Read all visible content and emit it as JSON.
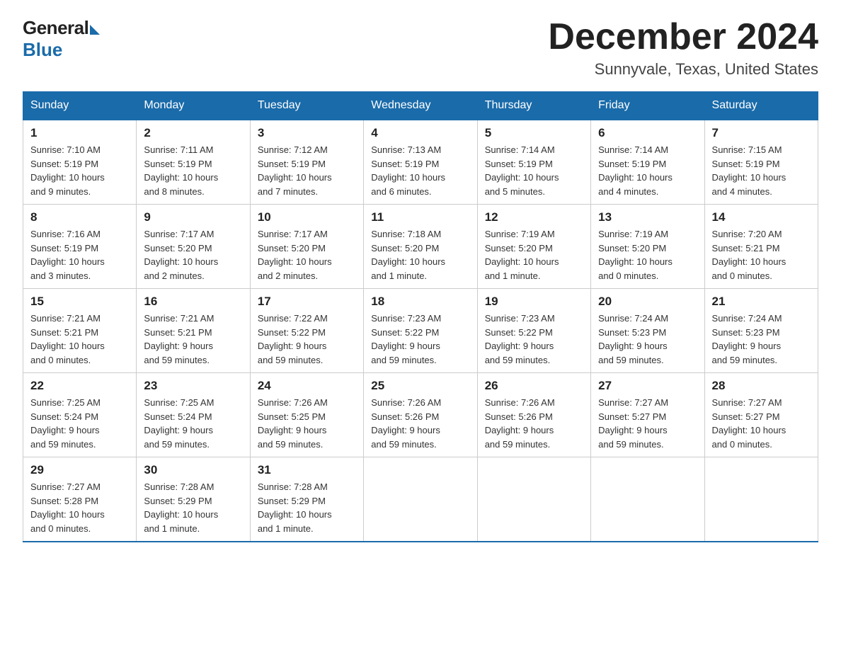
{
  "logo": {
    "general": "General",
    "blue": "Blue"
  },
  "title": "December 2024",
  "location": "Sunnyvale, Texas, United States",
  "days_of_week": [
    "Sunday",
    "Monday",
    "Tuesday",
    "Wednesday",
    "Thursday",
    "Friday",
    "Saturday"
  ],
  "weeks": [
    [
      {
        "day": "1",
        "info": "Sunrise: 7:10 AM\nSunset: 5:19 PM\nDaylight: 10 hours\nand 9 minutes."
      },
      {
        "day": "2",
        "info": "Sunrise: 7:11 AM\nSunset: 5:19 PM\nDaylight: 10 hours\nand 8 minutes."
      },
      {
        "day": "3",
        "info": "Sunrise: 7:12 AM\nSunset: 5:19 PM\nDaylight: 10 hours\nand 7 minutes."
      },
      {
        "day": "4",
        "info": "Sunrise: 7:13 AM\nSunset: 5:19 PM\nDaylight: 10 hours\nand 6 minutes."
      },
      {
        "day": "5",
        "info": "Sunrise: 7:14 AM\nSunset: 5:19 PM\nDaylight: 10 hours\nand 5 minutes."
      },
      {
        "day": "6",
        "info": "Sunrise: 7:14 AM\nSunset: 5:19 PM\nDaylight: 10 hours\nand 4 minutes."
      },
      {
        "day": "7",
        "info": "Sunrise: 7:15 AM\nSunset: 5:19 PM\nDaylight: 10 hours\nand 4 minutes."
      }
    ],
    [
      {
        "day": "8",
        "info": "Sunrise: 7:16 AM\nSunset: 5:19 PM\nDaylight: 10 hours\nand 3 minutes."
      },
      {
        "day": "9",
        "info": "Sunrise: 7:17 AM\nSunset: 5:20 PM\nDaylight: 10 hours\nand 2 minutes."
      },
      {
        "day": "10",
        "info": "Sunrise: 7:17 AM\nSunset: 5:20 PM\nDaylight: 10 hours\nand 2 minutes."
      },
      {
        "day": "11",
        "info": "Sunrise: 7:18 AM\nSunset: 5:20 PM\nDaylight: 10 hours\nand 1 minute."
      },
      {
        "day": "12",
        "info": "Sunrise: 7:19 AM\nSunset: 5:20 PM\nDaylight: 10 hours\nand 1 minute."
      },
      {
        "day": "13",
        "info": "Sunrise: 7:19 AM\nSunset: 5:20 PM\nDaylight: 10 hours\nand 0 minutes."
      },
      {
        "day": "14",
        "info": "Sunrise: 7:20 AM\nSunset: 5:21 PM\nDaylight: 10 hours\nand 0 minutes."
      }
    ],
    [
      {
        "day": "15",
        "info": "Sunrise: 7:21 AM\nSunset: 5:21 PM\nDaylight: 10 hours\nand 0 minutes."
      },
      {
        "day": "16",
        "info": "Sunrise: 7:21 AM\nSunset: 5:21 PM\nDaylight: 9 hours\nand 59 minutes."
      },
      {
        "day": "17",
        "info": "Sunrise: 7:22 AM\nSunset: 5:22 PM\nDaylight: 9 hours\nand 59 minutes."
      },
      {
        "day": "18",
        "info": "Sunrise: 7:23 AM\nSunset: 5:22 PM\nDaylight: 9 hours\nand 59 minutes."
      },
      {
        "day": "19",
        "info": "Sunrise: 7:23 AM\nSunset: 5:22 PM\nDaylight: 9 hours\nand 59 minutes."
      },
      {
        "day": "20",
        "info": "Sunrise: 7:24 AM\nSunset: 5:23 PM\nDaylight: 9 hours\nand 59 minutes."
      },
      {
        "day": "21",
        "info": "Sunrise: 7:24 AM\nSunset: 5:23 PM\nDaylight: 9 hours\nand 59 minutes."
      }
    ],
    [
      {
        "day": "22",
        "info": "Sunrise: 7:25 AM\nSunset: 5:24 PM\nDaylight: 9 hours\nand 59 minutes."
      },
      {
        "day": "23",
        "info": "Sunrise: 7:25 AM\nSunset: 5:24 PM\nDaylight: 9 hours\nand 59 minutes."
      },
      {
        "day": "24",
        "info": "Sunrise: 7:26 AM\nSunset: 5:25 PM\nDaylight: 9 hours\nand 59 minutes."
      },
      {
        "day": "25",
        "info": "Sunrise: 7:26 AM\nSunset: 5:26 PM\nDaylight: 9 hours\nand 59 minutes."
      },
      {
        "day": "26",
        "info": "Sunrise: 7:26 AM\nSunset: 5:26 PM\nDaylight: 9 hours\nand 59 minutes."
      },
      {
        "day": "27",
        "info": "Sunrise: 7:27 AM\nSunset: 5:27 PM\nDaylight: 9 hours\nand 59 minutes."
      },
      {
        "day": "28",
        "info": "Sunrise: 7:27 AM\nSunset: 5:27 PM\nDaylight: 10 hours\nand 0 minutes."
      }
    ],
    [
      {
        "day": "29",
        "info": "Sunrise: 7:27 AM\nSunset: 5:28 PM\nDaylight: 10 hours\nand 0 minutes."
      },
      {
        "day": "30",
        "info": "Sunrise: 7:28 AM\nSunset: 5:29 PM\nDaylight: 10 hours\nand 1 minute."
      },
      {
        "day": "31",
        "info": "Sunrise: 7:28 AM\nSunset: 5:29 PM\nDaylight: 10 hours\nand 1 minute."
      },
      {
        "day": "",
        "info": ""
      },
      {
        "day": "",
        "info": ""
      },
      {
        "day": "",
        "info": ""
      },
      {
        "day": "",
        "info": ""
      }
    ]
  ]
}
